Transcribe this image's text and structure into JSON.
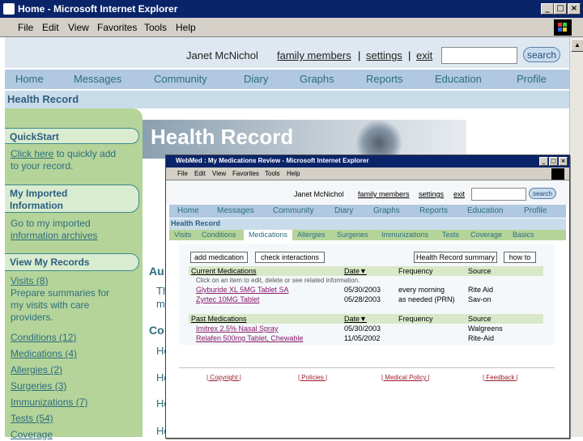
{
  "window": {
    "title": "Home - Microsoft Internet Explorer",
    "menu": [
      "File",
      "Edit",
      "View",
      "Favorites",
      "Tools",
      "Help"
    ]
  },
  "header": {
    "user_name": "Janet McNichol",
    "links": [
      "family members",
      "settings",
      "exit"
    ],
    "search_label": "search"
  },
  "nav": [
    "Home",
    "Messages",
    "Community",
    "Diary",
    "Graphs",
    "Reports",
    "Education",
    "Profile"
  ],
  "section_title": "Health Record",
  "banner_title": "Health Record",
  "left": {
    "quickstart_title": "QuickStart",
    "quickstart_link": "Click here",
    "quickstart_rest_1": " to quickly add",
    "quickstart_rest_2": "to your record.",
    "imported_title_1": "My Imported",
    "imported_title_2": "Information",
    "imported_text": "Go to my imported",
    "imported_link": "information archives",
    "view_title": "View My Records",
    "visits": "Visits (8)",
    "visits_desc_1": "Prepare summaries for",
    "visits_desc_2": "my visits with care",
    "visits_desc_3": "providers.",
    "records": [
      "Conditions (12)",
      "Medications (4)",
      "Allergies (2)",
      "Surgeries (3)",
      "Immunizations (7)",
      "Tests (54)",
      "Coverage"
    ]
  },
  "main_stubs": [
    "Au",
    "Th",
    "m",
    "Co",
    "Ho",
    "Ho",
    "Ho",
    "Ho"
  ],
  "popup": {
    "title": "WebMed : My Medications Review - Microsoft Internet Explorer",
    "menu": [
      "File",
      "Edit",
      "View",
      "Favorites",
      "Tools",
      "Help"
    ],
    "user_name": "Janet McNichol",
    "links": [
      "family members",
      "settings",
      "exit"
    ],
    "search_label": "search",
    "nav": [
      "Home",
      "Messages",
      "Community",
      "Diary",
      "Graphs",
      "Reports",
      "Education",
      "Profile"
    ],
    "section_title": "Health Record",
    "subtabs": [
      "Visits",
      "Conditions",
      "Medications",
      "Allergies",
      "Surgeries",
      "Immunizations",
      "Tests",
      "Coverage",
      "Basics"
    ],
    "buttons": {
      "add": "add medication",
      "check": "check interactions",
      "summary": "Health Record summary",
      "howto": "how to"
    },
    "current": {
      "header": [
        "Current Medications",
        "Date▼",
        "Frequency",
        "Source"
      ],
      "hint": "Click on an item to edit, delete or see related information.",
      "rows": [
        [
          "Glyburide XL 5MG Tablet SA",
          "05/30/2003",
          "every morning",
          "Rite Aid"
        ],
        [
          "Zyrtec 10MG Tablet",
          "05/28/2003",
          "as needed (PRN)",
          "Sav-on"
        ]
      ]
    },
    "past": {
      "header": [
        "Past Medications",
        "Date▼",
        "Frequency",
        "Source"
      ],
      "rows": [
        [
          "Imitrex 2.5% Nasal Spray",
          "05/30/2003",
          "",
          "Walgreens"
        ],
        [
          "Relafen 500mg Tablet, Chewable",
          "11/05/2002",
          "",
          "Rite-Aid"
        ]
      ]
    },
    "footer": [
      "| Copyright |",
      "| Policies |",
      "| Medical Policy |",
      "| Feedback |"
    ]
  },
  "colors": {
    "titlebar": "#0a246a",
    "nav_bg": "#b0c8e0",
    "left_panel": "#b5d49a",
    "link": "#2c6e7e"
  }
}
